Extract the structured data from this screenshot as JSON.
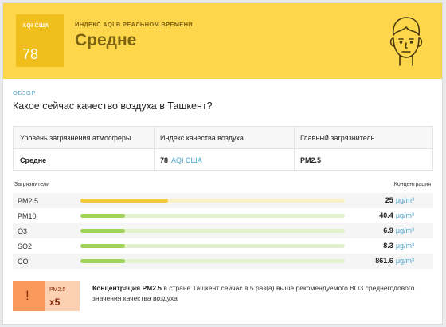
{
  "header": {
    "aqi_label": "AQI США",
    "aqi_value": "78",
    "caption": "ИНДЕКС AQI В РЕАЛЬНОМ ВРЕМЕНИ",
    "status": "Средне",
    "face_icon": "moderate-face-icon",
    "color_bg": "#fdd64b",
    "color_box": "#f0be1d"
  },
  "overview": {
    "label": "ОБЗОР",
    "question": "Какое сейчас качество воздуха в Ташкент?"
  },
  "summary": {
    "headers": [
      "Уровень загрязнения атмосферы",
      "Индекс качества воздуха",
      "Главный загрязнитель"
    ],
    "level": "Средне",
    "aqi_value": "78",
    "aqi_unit": "AQI США",
    "main_pollutant": "PM2.5"
  },
  "pollutants": {
    "header_left": "Загрязнители",
    "header_right": "Концентрация",
    "unit": "μg/m³",
    "items": [
      {
        "name": "PM2.5",
        "value": "25",
        "fill": 0.33,
        "color": "#f0c93a",
        "track": "#faf0c8"
      },
      {
        "name": "PM10",
        "value": "40.4",
        "fill": 0.17,
        "color": "#9fd35a",
        "track": "#e2f2cc"
      },
      {
        "name": "O3",
        "value": "6.9",
        "fill": 0.17,
        "color": "#9fd35a",
        "track": "#e2f2cc"
      },
      {
        "name": "SO2",
        "value": "8.3",
        "fill": 0.17,
        "color": "#9fd35a",
        "track": "#e2f2cc"
      },
      {
        "name": "CO",
        "value": "861.6",
        "fill": 0.17,
        "color": "#9fd35a",
        "track": "#e2f2cc"
      }
    ]
  },
  "alert": {
    "icon": "exclamation-icon",
    "icon_text": "!",
    "pollutant": "PM2.5",
    "multiplier": "x5",
    "bold_text": "Концентрация PM2.5",
    "text": " в стране Ташкент сейчас в 5 раз(а) выше рекомендуемого ВОЗ среднегодового значения качества воздуха"
  }
}
